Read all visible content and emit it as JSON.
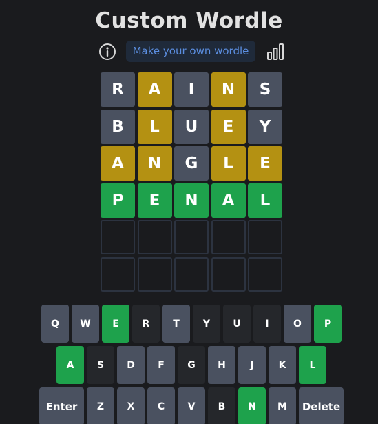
{
  "header": {
    "title": "Custom Wordle",
    "make_button_label": "Make your own wordle"
  },
  "icons": {
    "info": "info-icon",
    "stats": "stats-icon"
  },
  "colors": {
    "background": "#1a1b1e",
    "absent_tile": "#4a5160",
    "present": "#b49112",
    "correct": "#1ea24c",
    "absent_key": "#25272b",
    "link_blue": "#5b8ee0"
  },
  "board": {
    "rows": [
      [
        {
          "letter": "R",
          "state": "absent"
        },
        {
          "letter": "A",
          "state": "present"
        },
        {
          "letter": "I",
          "state": "absent"
        },
        {
          "letter": "N",
          "state": "present"
        },
        {
          "letter": "S",
          "state": "absent"
        }
      ],
      [
        {
          "letter": "B",
          "state": "absent"
        },
        {
          "letter": "L",
          "state": "present"
        },
        {
          "letter": "U",
          "state": "absent"
        },
        {
          "letter": "E",
          "state": "present"
        },
        {
          "letter": "Y",
          "state": "absent"
        }
      ],
      [
        {
          "letter": "A",
          "state": "present"
        },
        {
          "letter": "N",
          "state": "present"
        },
        {
          "letter": "G",
          "state": "absent"
        },
        {
          "letter": "L",
          "state": "present"
        },
        {
          "letter": "E",
          "state": "present"
        }
      ],
      [
        {
          "letter": "P",
          "state": "correct"
        },
        {
          "letter": "E",
          "state": "correct"
        },
        {
          "letter": "N",
          "state": "correct"
        },
        {
          "letter": "A",
          "state": "correct"
        },
        {
          "letter": "L",
          "state": "correct"
        }
      ],
      [
        {
          "letter": "",
          "state": "empty"
        },
        {
          "letter": "",
          "state": "empty"
        },
        {
          "letter": "",
          "state": "empty"
        },
        {
          "letter": "",
          "state": "empty"
        },
        {
          "letter": "",
          "state": "empty"
        }
      ],
      [
        {
          "letter": "",
          "state": "empty"
        },
        {
          "letter": "",
          "state": "empty"
        },
        {
          "letter": "",
          "state": "empty"
        },
        {
          "letter": "",
          "state": "empty"
        },
        {
          "letter": "",
          "state": "empty"
        }
      ]
    ]
  },
  "keyboard": {
    "rows": [
      [
        {
          "label": "Q",
          "state": "unused"
        },
        {
          "label": "W",
          "state": "unused"
        },
        {
          "label": "E",
          "state": "correct"
        },
        {
          "label": "R",
          "state": "absent"
        },
        {
          "label": "T",
          "state": "unused"
        },
        {
          "label": "Y",
          "state": "absent"
        },
        {
          "label": "U",
          "state": "absent"
        },
        {
          "label": "I",
          "state": "absent"
        },
        {
          "label": "O",
          "state": "unused"
        },
        {
          "label": "P",
          "state": "correct"
        }
      ],
      [
        {
          "label": "A",
          "state": "correct"
        },
        {
          "label": "S",
          "state": "absent"
        },
        {
          "label": "D",
          "state": "unused"
        },
        {
          "label": "F",
          "state": "unused"
        },
        {
          "label": "G",
          "state": "absent"
        },
        {
          "label": "H",
          "state": "unused"
        },
        {
          "label": "J",
          "state": "unused"
        },
        {
          "label": "K",
          "state": "unused"
        },
        {
          "label": "L",
          "state": "correct"
        }
      ],
      [
        {
          "label": "Enter",
          "state": "unused"
        },
        {
          "label": "Z",
          "state": "unused"
        },
        {
          "label": "X",
          "state": "unused"
        },
        {
          "label": "C",
          "state": "unused"
        },
        {
          "label": "V",
          "state": "unused"
        },
        {
          "label": "B",
          "state": "absent"
        },
        {
          "label": "N",
          "state": "correct"
        },
        {
          "label": "M",
          "state": "unused"
        },
        {
          "label": "Delete",
          "state": "unused"
        }
      ]
    ]
  }
}
